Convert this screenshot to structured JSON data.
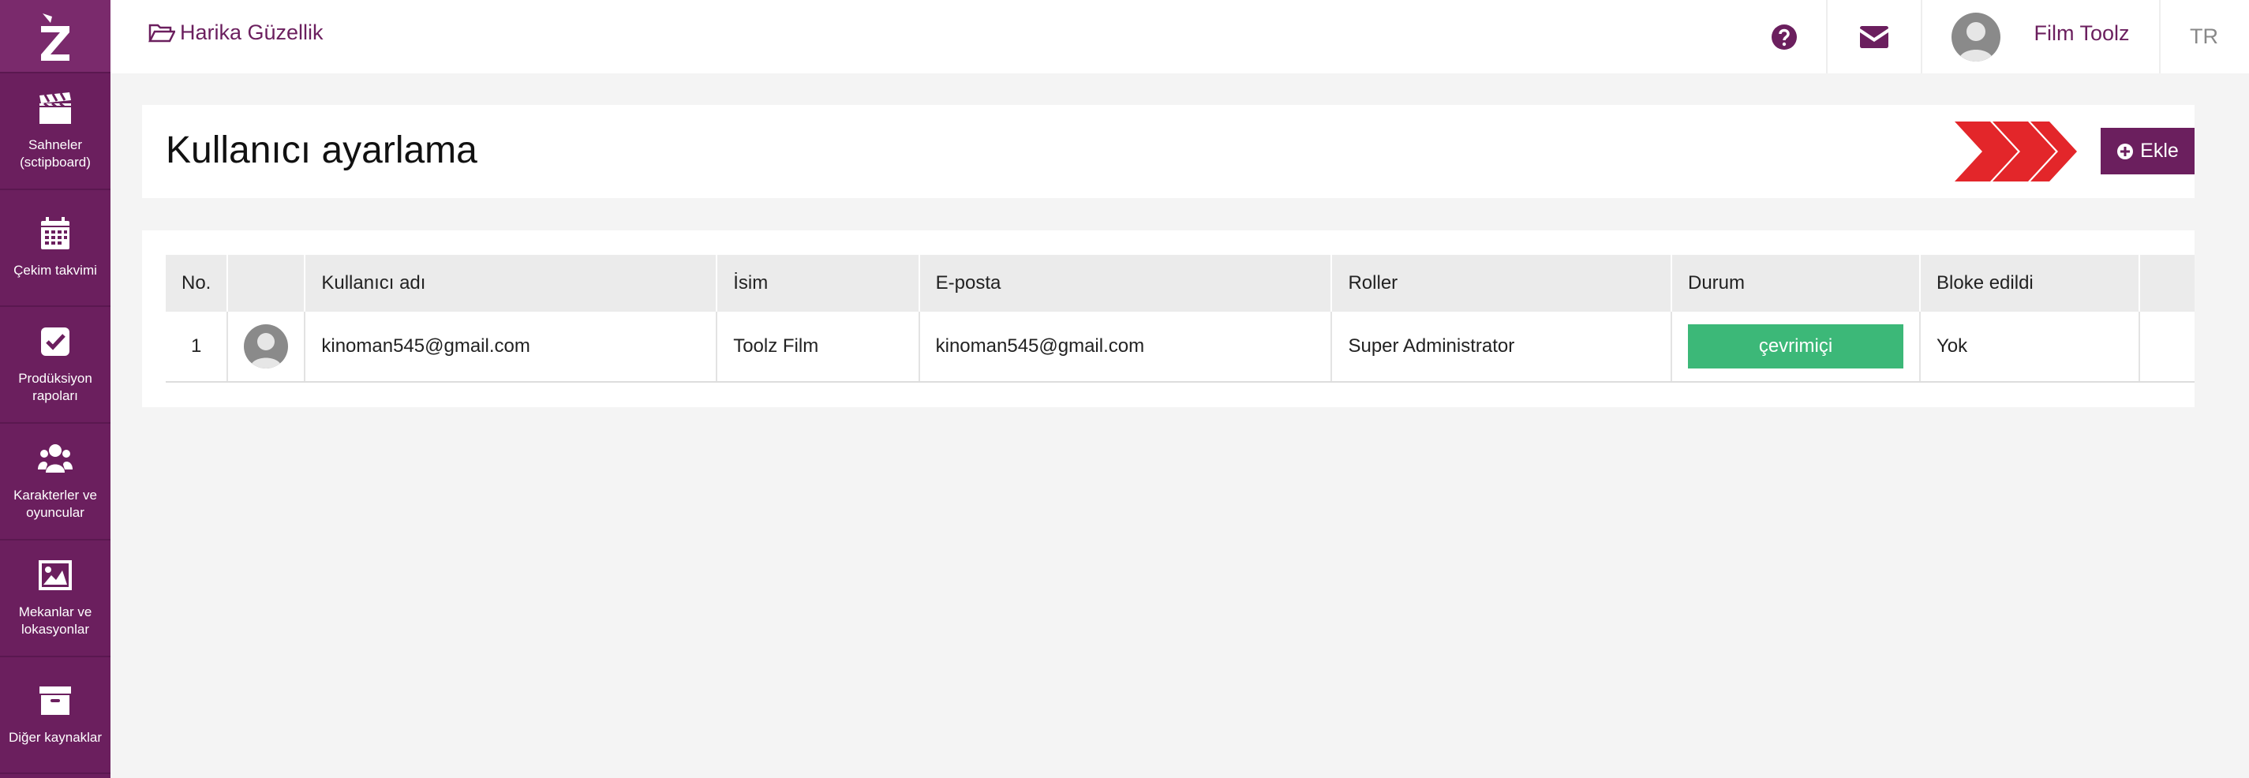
{
  "colors": {
    "brand": "#6b1f5e",
    "status_online": "#3cb878",
    "accent_arrows": "#e3262a"
  },
  "sidebar": {
    "logo_icon": "z-logo-icon",
    "items": [
      {
        "label": "Sahneler (sctipboard)",
        "icon": "clapperboard-icon"
      },
      {
        "label": "Çekim takvimi",
        "icon": "calendar-icon"
      },
      {
        "label": "Prodüksiyon rapoları",
        "icon": "checkbox-icon"
      },
      {
        "label": "Karakterler ve oyuncular",
        "icon": "users-icon"
      },
      {
        "label": "Mekanlar ve lokasyonlar",
        "icon": "image-icon"
      },
      {
        "label": "Diğer kaynaklar",
        "icon": "archive-icon"
      }
    ]
  },
  "topbar": {
    "project_icon": "folder-open-icon",
    "project_name": "Harika Güzellik",
    "help_icon": "question-circle-icon",
    "mail_icon": "envelope-icon",
    "user_name": "Film Toolz",
    "language": "TR"
  },
  "page": {
    "title": "Kullanıcı ayarlama",
    "add_button": "Ekle"
  },
  "table": {
    "headers": [
      "No.",
      "",
      "Kullanıcı adı",
      "İsim",
      "E-posta",
      "Roller",
      "Durum",
      "Bloke edildi",
      ""
    ],
    "rows": [
      {
        "no": "1",
        "username": "kinoman545@gmail.com",
        "name": "Toolz Film",
        "email": "kinoman545@gmail.com",
        "roles": "Super Administrator",
        "status": "çevrimiçi",
        "blocked": "Yok"
      }
    ]
  }
}
